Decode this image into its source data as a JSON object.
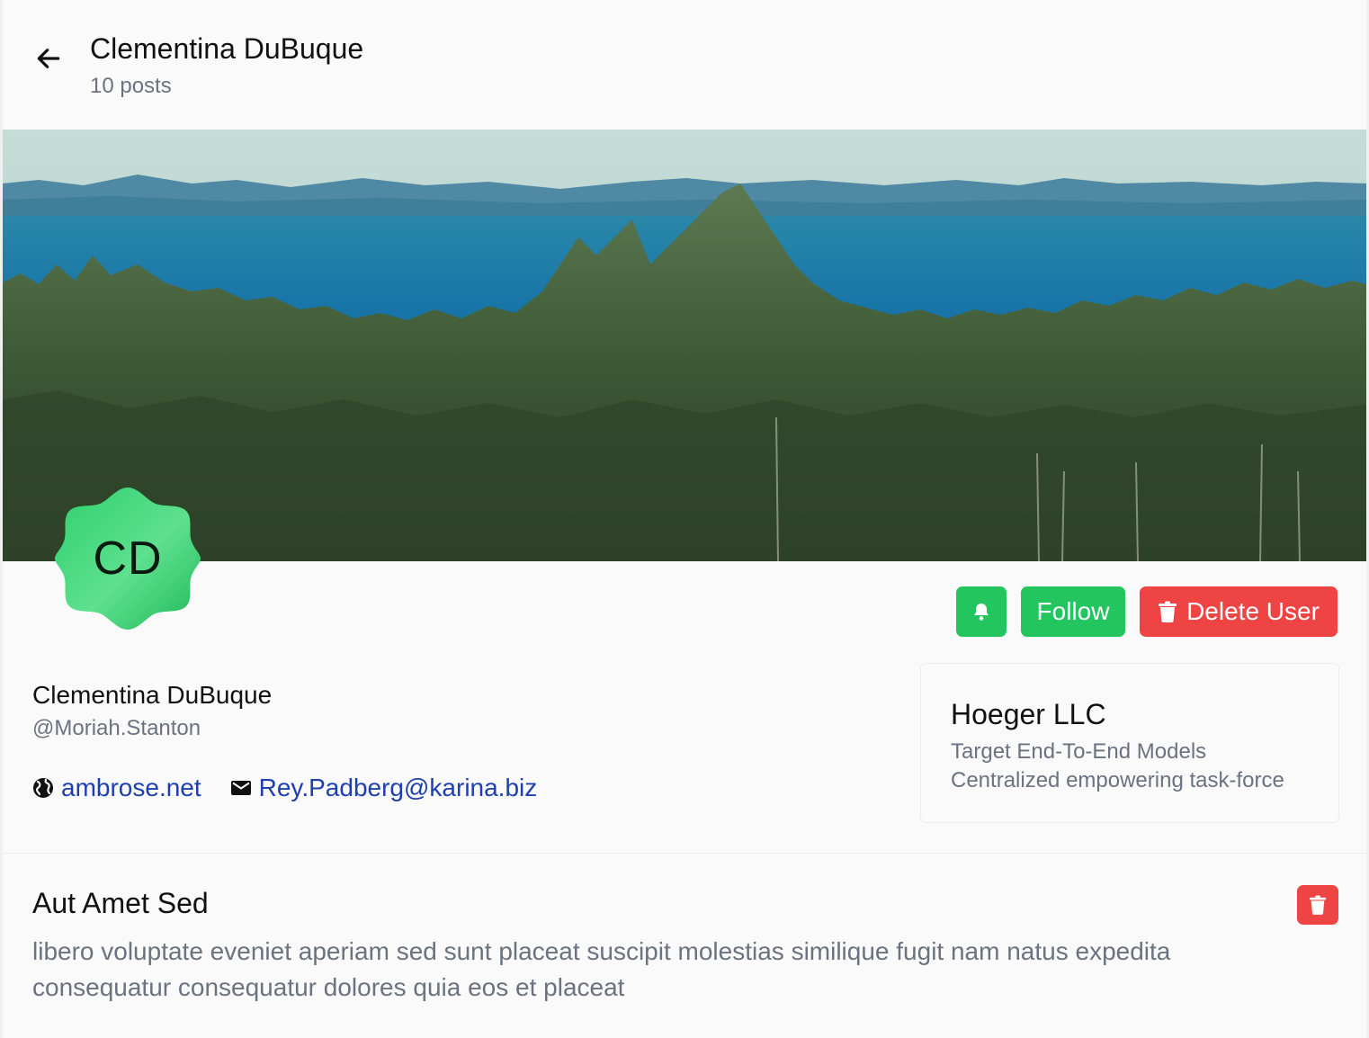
{
  "header": {
    "title": "Clementina DuBuque",
    "subtitle": "10 posts"
  },
  "avatar": {
    "initials": "CD",
    "color": "#22c55e"
  },
  "actions": {
    "follow_label": "Follow",
    "delete_label": "Delete User"
  },
  "user": {
    "name": "Clementina DuBuque",
    "handle": "@Moriah.Stanton",
    "website": "ambrose.net",
    "email": "Rey.Padberg@karina.biz"
  },
  "company": {
    "name": "Hoeger LLC",
    "catch_phrase": "Target End-To-End Models",
    "bs": "Centralized empowering task-force"
  },
  "post": {
    "title": "Aut Amet Sed",
    "body": "libero voluptate eveniet aperiam sed sunt placeat suscipit molestias similique fugit nam natus expedita consequatur consequatur dolores quia eos et placeat"
  },
  "colors": {
    "accent_green": "#22c55e",
    "danger_red": "#ef4444",
    "link_blue": "#1e40af"
  },
  "icons": [
    "arrow-left-icon",
    "bell-icon",
    "trash-icon",
    "globe-icon",
    "mail-icon"
  ]
}
